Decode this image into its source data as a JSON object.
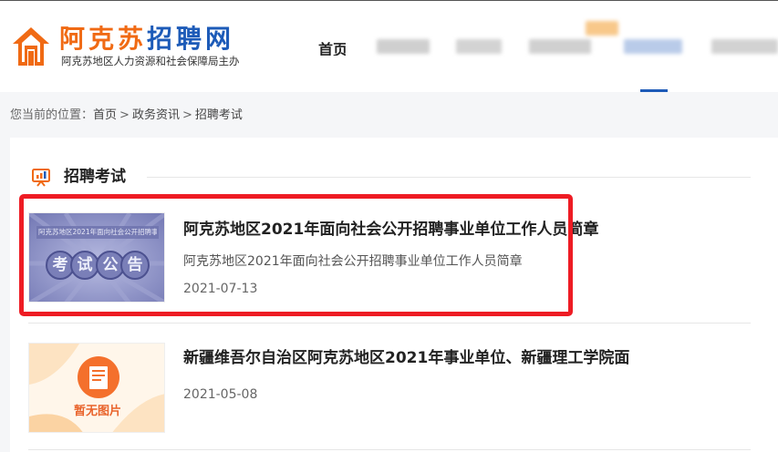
{
  "header": {
    "logo_title_part1": "阿克苏",
    "logo_title_part2": "招聘网",
    "logo_subtitle": "阿克苏地区人力资源和社会保障局主办",
    "nav_first": "首页",
    "nav_items_blurred": 6
  },
  "breadcrumb": {
    "prefix": "您当前的位置：",
    "items": [
      "首页",
      "政务资讯",
      "招聘考试"
    ],
    "separator": ">"
  },
  "section": {
    "title": "招聘考试"
  },
  "articles": [
    {
      "title": "阿克苏地区2021年面向社会公开招聘事业单位工作人员简章",
      "summary": "阿克苏地区2021年面向社会公开招聘事业单位工作人员简章",
      "date": "2021-07-13",
      "thumb_banner": "阿克苏地区2021年面向社会公开招聘事业单位",
      "thumb_chars": [
        "考",
        "试",
        "公",
        "告"
      ]
    },
    {
      "title": "新疆维吾尔自治区阿克苏地区2021年事业单位、新疆理工学院面",
      "summary": "",
      "date": "2021-05-08",
      "thumb_label": "暂无图片"
    }
  ],
  "colors": {
    "brand_orange": "#f06a14",
    "brand_blue": "#1d5bb8",
    "highlight_red": "#ee1c24",
    "thumb_purple": "#8a8fc4"
  }
}
